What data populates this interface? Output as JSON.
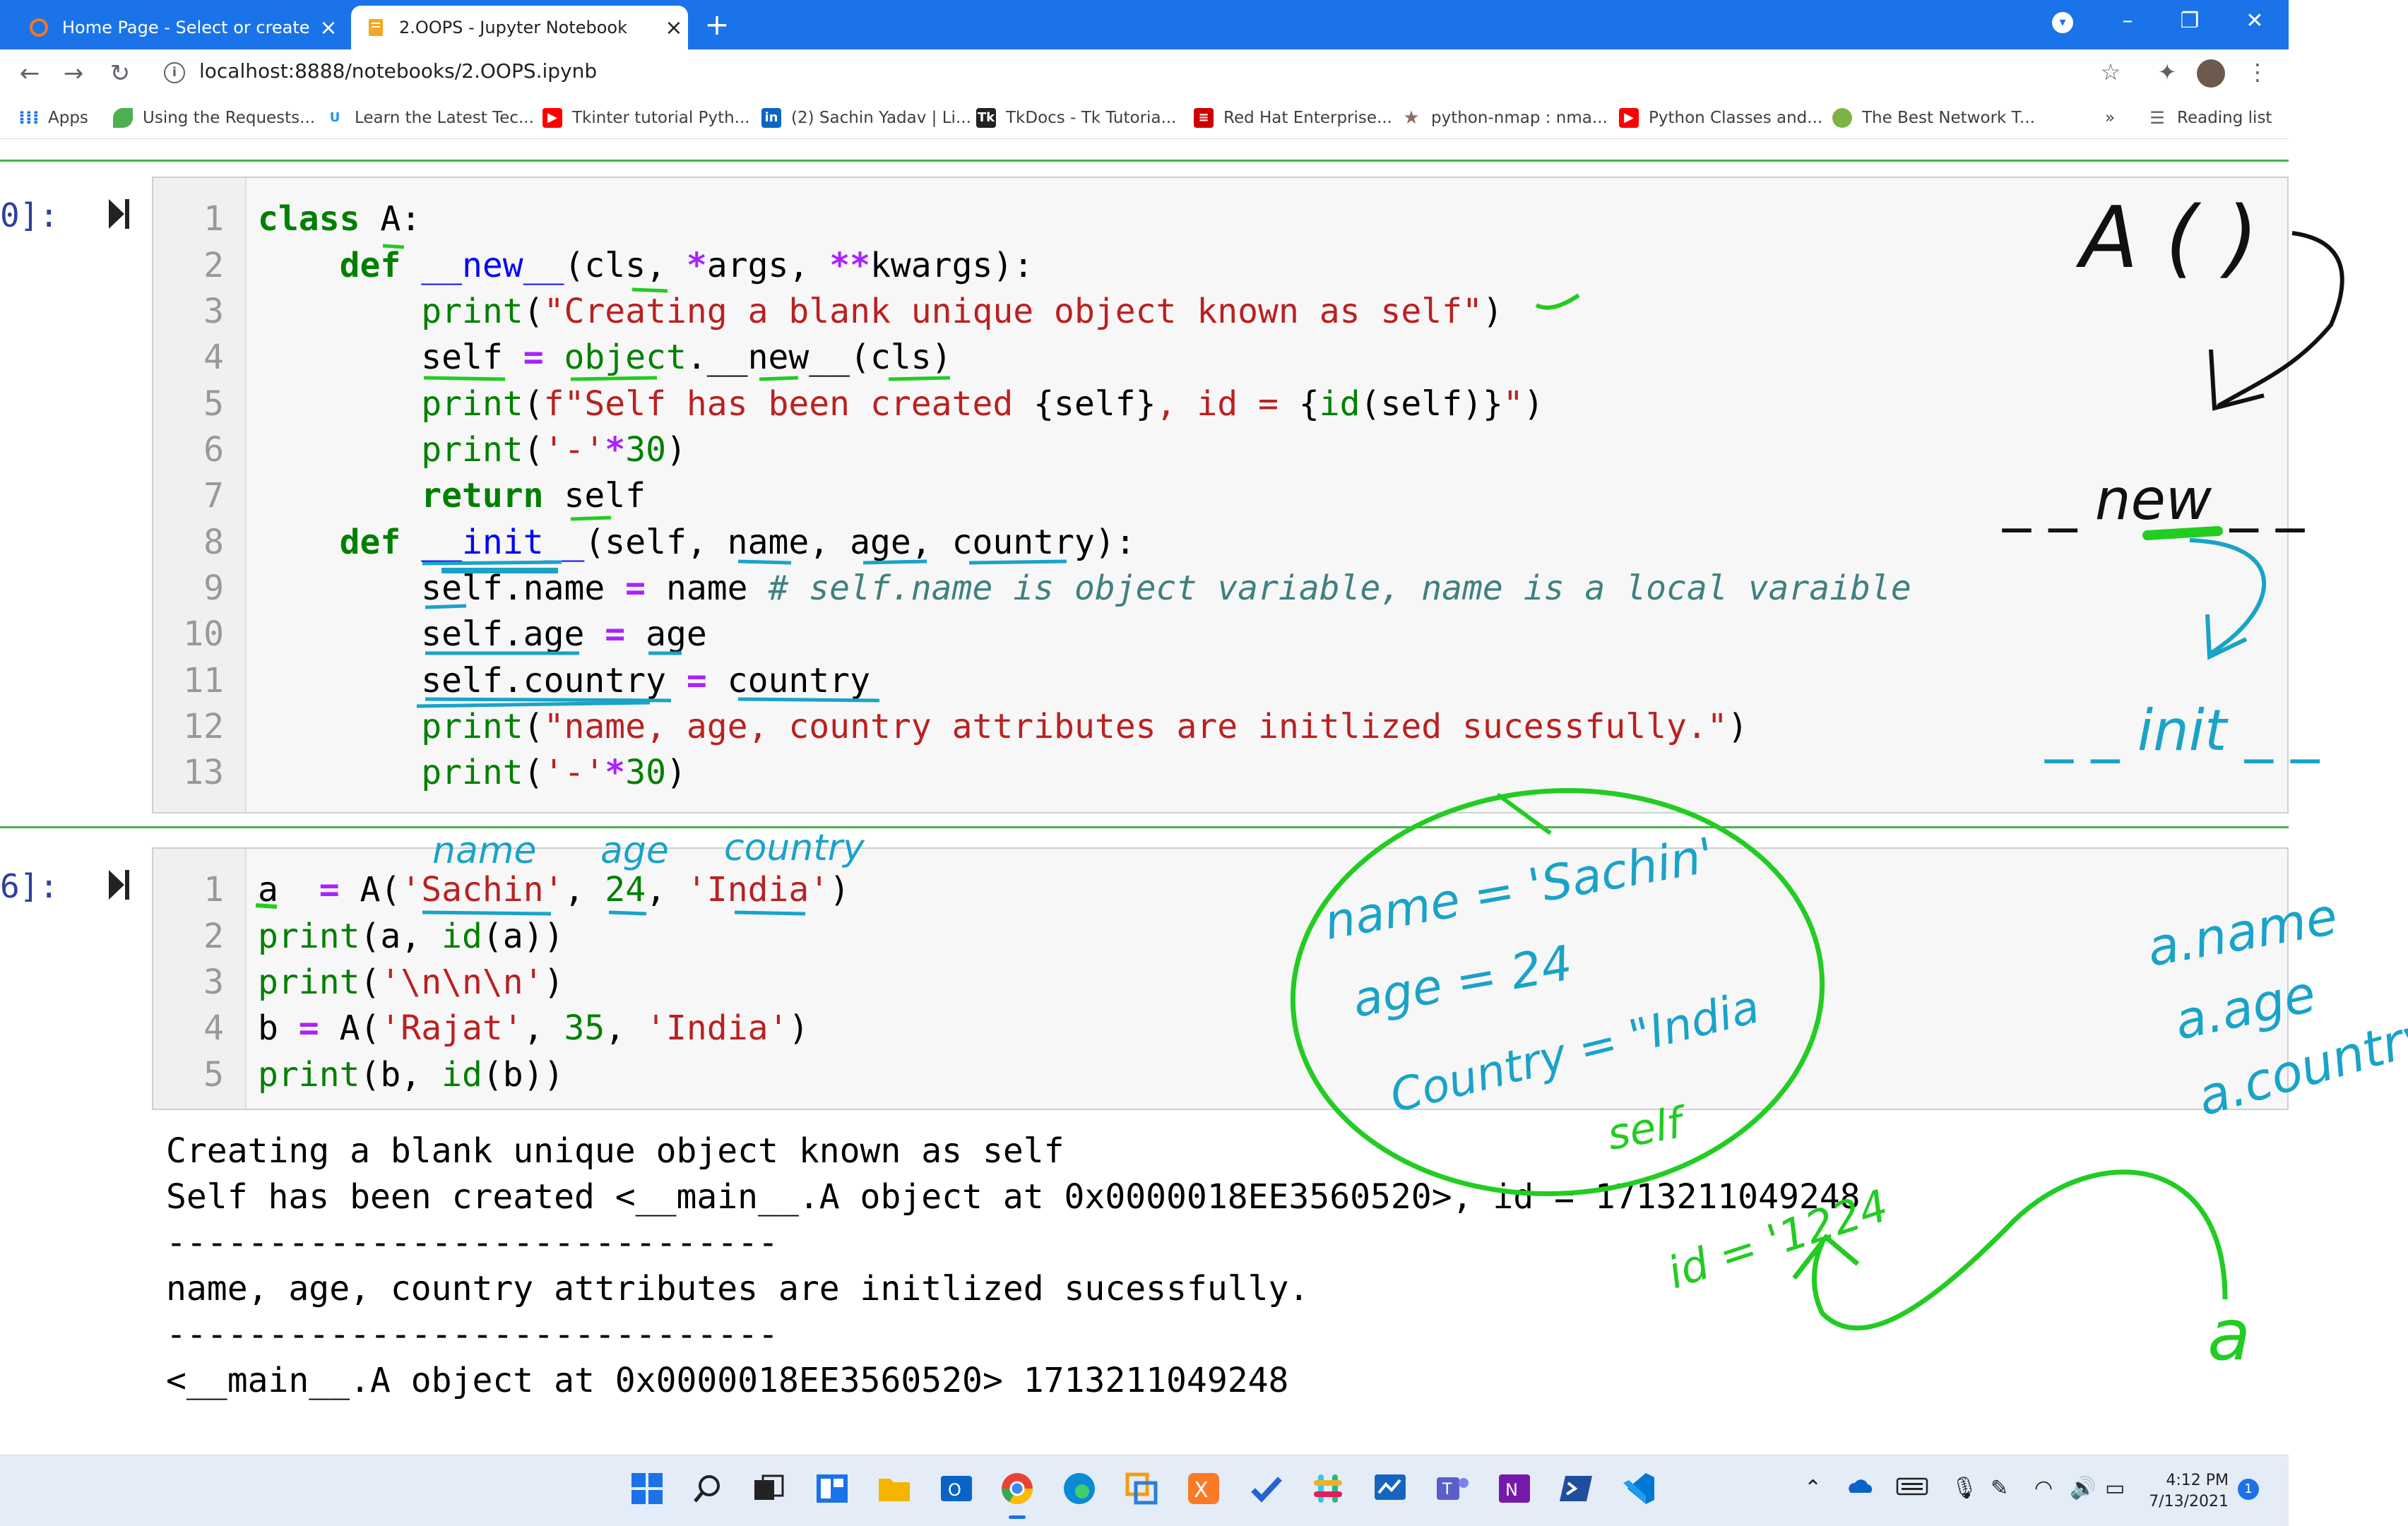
{
  "browser": {
    "tabs": [
      {
        "title": "Home Page - Select or create a n",
        "active": false
      },
      {
        "title": "2.OOPS - Jupyter Notebook",
        "active": true
      }
    ],
    "url": "localhost:8888/notebooks/2.OOPS.ipynb",
    "bookmarks": [
      {
        "label": "Apps",
        "icon": "apps-grid-icon"
      },
      {
        "label": "Using the Requests...",
        "icon": "leaf-icon"
      },
      {
        "label": "Learn the Latest Tec...",
        "icon": "udemy-icon"
      },
      {
        "label": "Tkinter tutorial Pyth...",
        "icon": "youtube-icon"
      },
      {
        "label": "(2) Sachin Yadav | Li...",
        "icon": "linkedin-icon"
      },
      {
        "label": "TkDocs - Tk Tutoria...",
        "icon": "tk-icon"
      },
      {
        "label": "Red Hat Enterprise...",
        "icon": "redhat-icon"
      },
      {
        "label": "python-nmap : nma...",
        "icon": "star-icon"
      },
      {
        "label": "Python Classes and...",
        "icon": "youtube-icon"
      },
      {
        "label": "The Best Network T...",
        "icon": "network-icon"
      }
    ],
    "more_bookmarks": "»",
    "reading_list": "Reading list"
  },
  "notebook": {
    "cell1": {
      "prompt": "0]:",
      "line_numbers": [
        "1",
        "2",
        "3",
        "4",
        "5",
        "6",
        "7",
        "8",
        "9",
        "10",
        "11",
        "12",
        "13"
      ]
    },
    "cell2": {
      "prompt": "6]:",
      "line_numbers": [
        "1",
        "2",
        "3",
        "4",
        "5"
      ]
    },
    "output": [
      "Creating a blank unique object known as self",
      "Self has been created <__main__.A object at 0x0000018EE3560520>, id = 1713211049248",
      "------------------------------",
      "name, age, country attributes are initlized sucessfully.",
      "------------------------------",
      "<__main__.A object at 0x0000018EE3560520> 1713211049248"
    ]
  },
  "annotations": {
    "call": "A (  )",
    "new": "_ _ new _ _",
    "init": "_ _ init _ _",
    "circle_lines": [
      "name = 'Sachin'",
      "age  = 24",
      "Country = \"India"
    ],
    "circle_label": "self",
    "param_labels": [
      "name",
      "age",
      "country"
    ],
    "right_notes": [
      "a.name",
      "a.age",
      "a.country"
    ],
    "id_note": "id = '1224",
    "var_a": "a",
    "ink_green": "#22cc22",
    "ink_blue": "#1aa3c8"
  },
  "taskbar": {
    "apps": [
      "windows-start-icon",
      "search-icon",
      "task-view-icon",
      "widgets-icon",
      "file-explorer-icon",
      "outlook-icon",
      "chrome-icon",
      "edge-icon",
      "vmware-icon",
      "xampp-icon",
      "todo-icon",
      "slack-icon",
      "whiteboard-icon",
      "teams-icon",
      "onenote-icon",
      "powershell-icon",
      "vscode-icon"
    ],
    "time": "4:12 PM",
    "date": "7/13/2021",
    "notifications": "1"
  }
}
